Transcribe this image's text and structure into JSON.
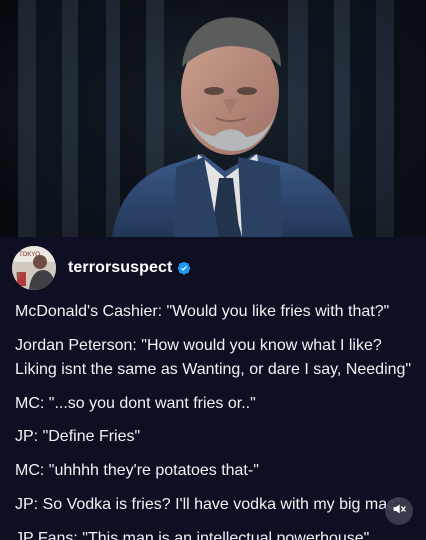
{
  "post": {
    "username": "terrorsuspect",
    "verified": true,
    "avatar_text": [
      "TOKYO",
      "B"
    ],
    "lines": [
      "McDonald's Cashier: \"Would you like fries with that?\"",
      "Jordan Peterson: \"How would you know what I like?",
      "Liking isnt the same as Wanting, or dare I say, Needing\"",
      "MC: \"...so you dont want fries or..\"",
      "JP: \"Define Fries\"",
      "MC: \"uhhhh they're potatoes that-\"",
      "JP: So Vodka is fries? I'll have vodka with my big mac\"",
      "JP Fans: \"This man is an intellectual powerhouse\""
    ]
  },
  "icons": {
    "verified": "verified-badge-icon",
    "mute": "volume-muted-icon"
  },
  "colors": {
    "background": "#0f0f23",
    "text": "#f2f2f5",
    "verified": "#1d9bf0"
  }
}
